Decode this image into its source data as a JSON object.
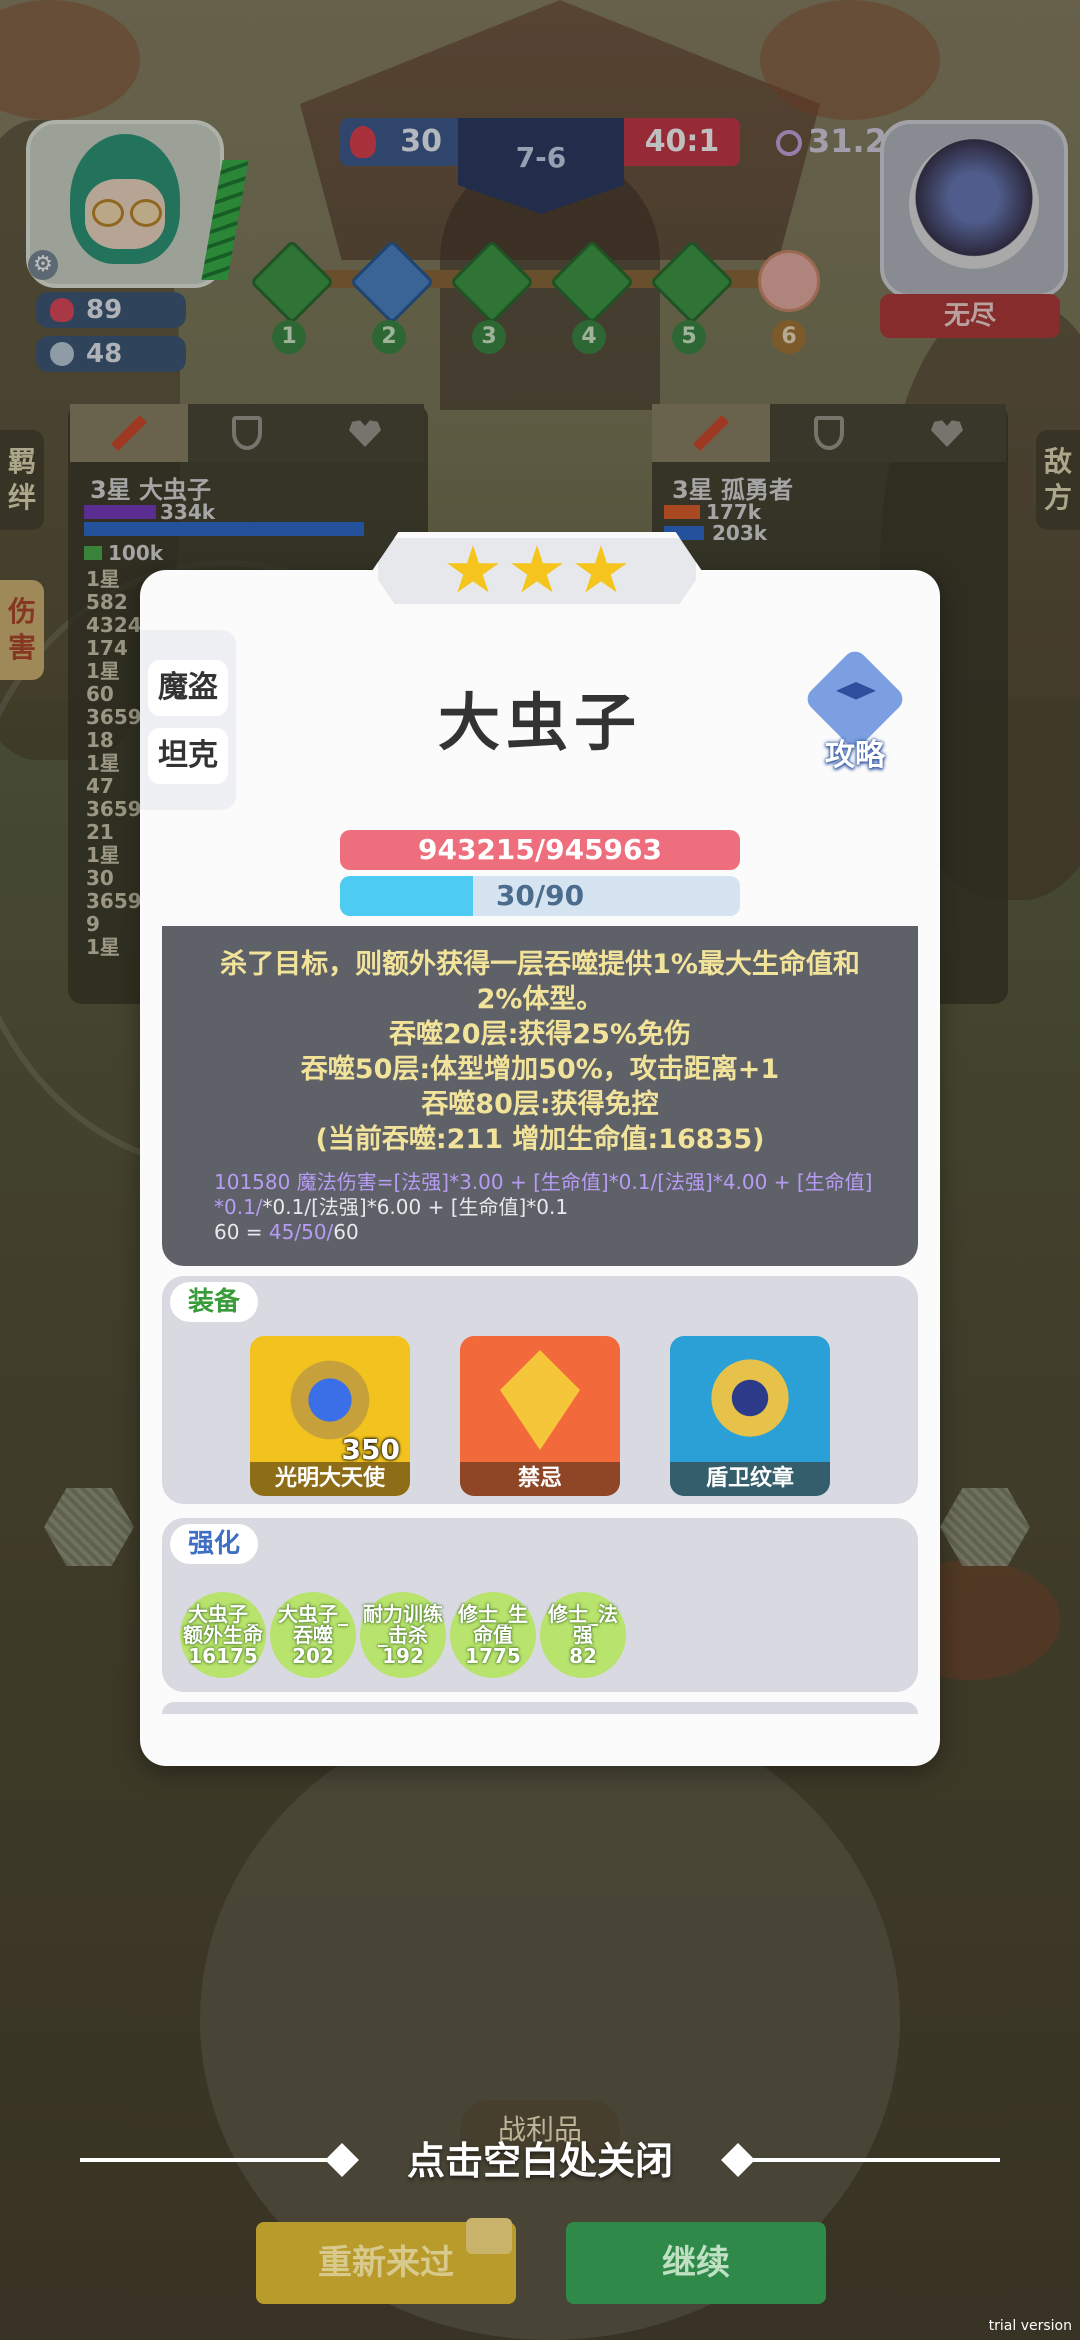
{
  "hud": {
    "player_hp": "89",
    "player_coins": "48",
    "score_left": "30",
    "round": "7-6",
    "score_right": "40:1",
    "timer": "31.2",
    "enemy_name": "无尽",
    "stages": [
      "1",
      "2",
      "3",
      "4",
      "5",
      "6"
    ]
  },
  "side_tabs": {
    "left_top": "羁绊",
    "left_active": "伤害",
    "right_top": "敌方"
  },
  "left_panel": {
    "unit": "3星 大虫子",
    "bar1_value": "334k",
    "bar2_value": "100k",
    "col_text": [
      "1星",
      "582",
      "4324",
      "174",
      "1星",
      "60",
      "3659",
      "18",
      "1星",
      "47",
      "3659",
      "21",
      "1星",
      "30",
      "3659",
      "9",
      "1星"
    ]
  },
  "right_panel": {
    "unit": "3星 孤勇者",
    "bar1_value": "177k",
    "bar2_value": "203k"
  },
  "modal": {
    "stars": 3,
    "classes": [
      "魔盗",
      "坦克"
    ],
    "hero_name": "大虫子",
    "guide_label": "攻略",
    "hp_text": "943215/945963",
    "mp_text": "30/90",
    "mp_fraction": 0.333,
    "skill_lines": [
      "杀了目标，则额外获得一层吞噬提供1%最大生命值和",
      "2%体型。",
      "吞噬20层:获得25%免伤",
      "吞噬50层:体型增加50%，攻击距离+1",
      "吞噬80层:获得免控",
      "(当前吞噬:211 增加生命值:16835)"
    ],
    "formula_line1_purple": "101580 魔法伤害=",
    "formula_line1_rest": "[法强]*3.00 + [生命值]*0.1/[法强]*4.00 + [生命值]",
    "formula_line2": "*0.1/[法强]*6.00 + [生命值]*0.1",
    "formula_line3_a": "60 = ",
    "formula_line3_b": "45/50/",
    "formula_line3_c": "60",
    "equip_title": "装备",
    "equipment": [
      {
        "name": "光明大天使",
        "level": "350",
        "color": "#f2c21e"
      },
      {
        "name": "禁忌",
        "color": "#f26a3c"
      },
      {
        "name": "盾卫纹章",
        "color": "#2aa0d6"
      }
    ],
    "enhance_title": "强化",
    "buffs": [
      {
        "line1": "大虫子_",
        "line2": "额外生命",
        "value": "16175"
      },
      {
        "line1": "大虫子_",
        "line2": "吞噬",
        "value": "202"
      },
      {
        "line1": "耐力训练",
        "line2": "_击杀",
        "value": "192"
      },
      {
        "line1": "修士_生",
        "line2": "命值",
        "value": "1775"
      },
      {
        "line1": "修士_法",
        "line2": "强",
        "value": "82"
      }
    ]
  },
  "bottom": {
    "close_hint": "点击空白处关闭",
    "battle_label": "战利品",
    "retry_label": "重新来过",
    "continue_label": "继续",
    "watermark": "trial version"
  }
}
